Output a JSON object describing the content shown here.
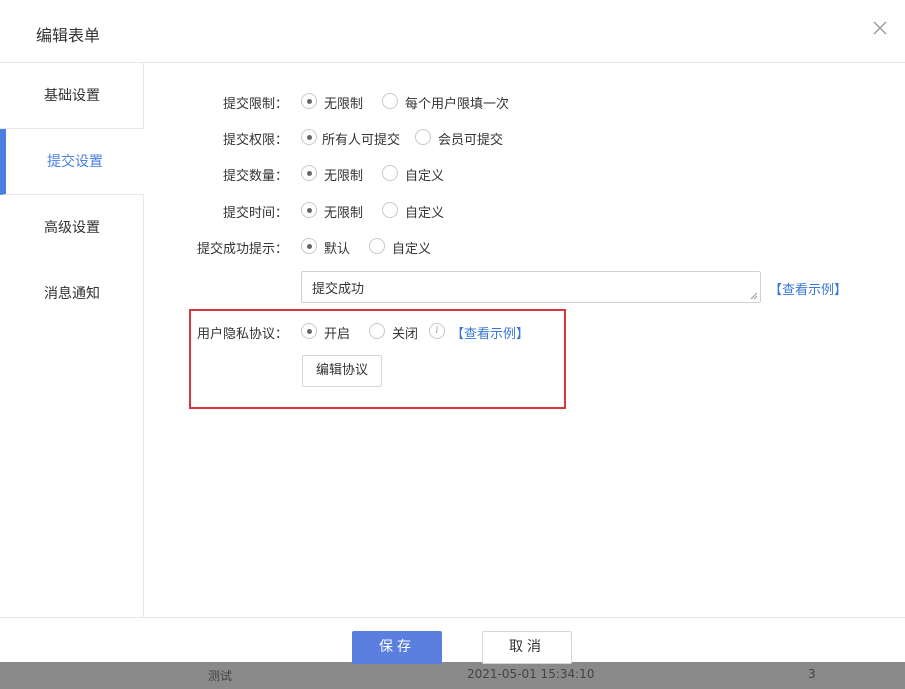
{
  "dialog": {
    "title": "编辑表单",
    "close_icon": "close-icon"
  },
  "sidebar": {
    "items": [
      {
        "label": "基础设置",
        "active": false
      },
      {
        "label": "提交设置",
        "active": true
      },
      {
        "label": "高级设置",
        "active": false
      },
      {
        "label": "消息通知",
        "active": false
      }
    ]
  },
  "form": {
    "submit_limit": {
      "label": "提交限制：",
      "options": [
        "无限制",
        "每个用户限填一次"
      ],
      "selected": 0
    },
    "submit_permission": {
      "label": "提交权限：",
      "options": [
        "所有人可提交",
        "会员可提交"
      ],
      "selected": 0
    },
    "submit_count": {
      "label": "提交数量：",
      "options": [
        "无限制",
        "自定义"
      ],
      "selected": 0
    },
    "submit_time": {
      "label": "提交时间：",
      "options": [
        "无限制",
        "自定义"
      ],
      "selected": 0
    },
    "success_tip": {
      "label": "提交成功提示：",
      "options": [
        "默认",
        "自定义"
      ],
      "selected": 0,
      "value": "提交成功",
      "example_link": "【查看示例】"
    },
    "privacy": {
      "label": "用户隐私协议：",
      "options": [
        "开启",
        "关闭"
      ],
      "selected": 0,
      "example_link": "【查看示例】",
      "info_icon": "info-icon",
      "edit_button": "编辑协议"
    }
  },
  "footer": {
    "save": "保存",
    "cancel": "取消"
  },
  "background": {
    "row_name": "测试",
    "row_time": "2021-05-01 15:34:10",
    "row_count": "3"
  },
  "colors": {
    "accent": "#5b7fde",
    "link": "#3a78d4",
    "highlight": "#d9363e"
  }
}
